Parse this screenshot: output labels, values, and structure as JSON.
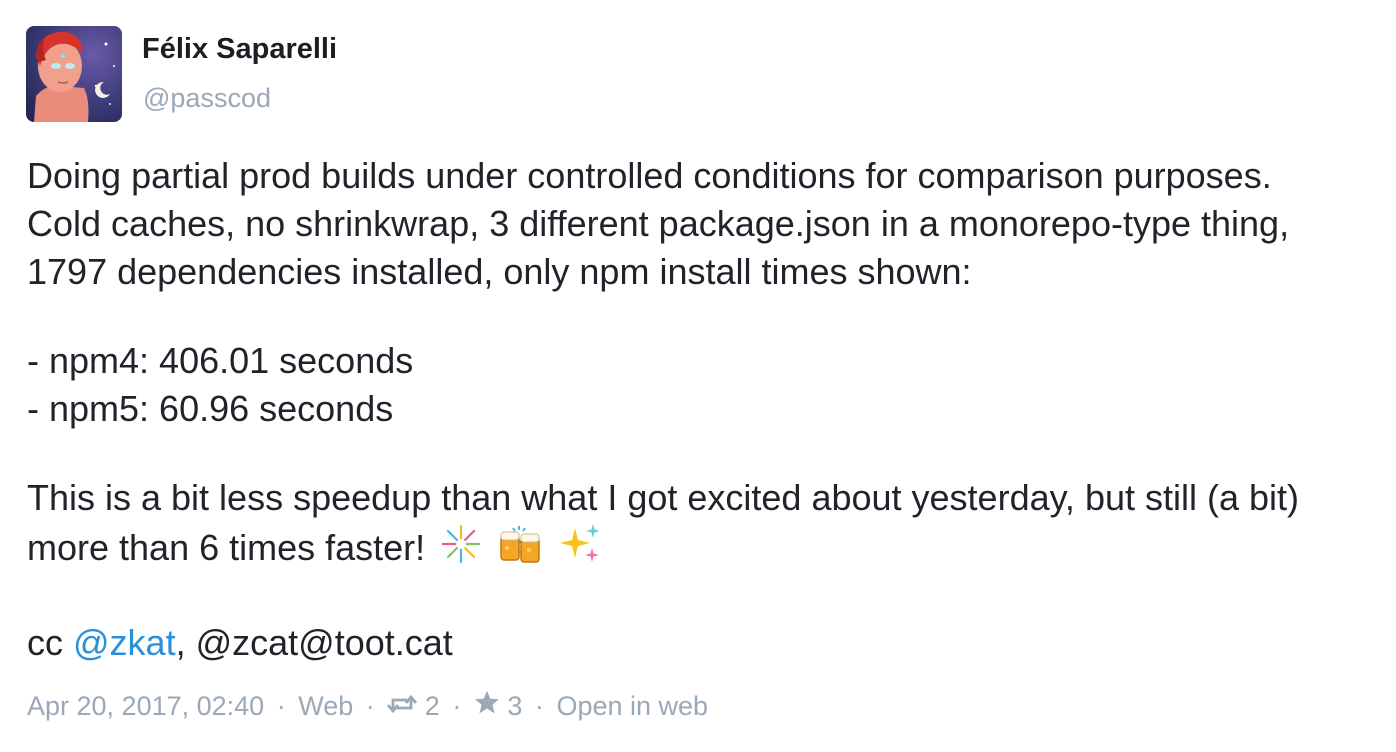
{
  "author": {
    "display_name": "Félix Saparelli",
    "handle": "@passcod"
  },
  "toot": {
    "paragraph1": [
      "Doing partial prod builds under controlled conditions for comparison purposes.",
      "Cold caches, no shrinkwrap, 3 different package.json in a monorepo-type thing,",
      "1797 dependencies installed, only npm install times shown:"
    ],
    "paragraph2": [
      "- npm4: 406.01 seconds",
      "- npm5: 60.96 seconds"
    ],
    "paragraph3_line1": "This is a bit less speedup than what I got excited about yesterday, but still (a bit)",
    "paragraph3_line2": "more than 6 times faster!",
    "emojis": [
      "fireworks-emoji",
      "beers-emoji",
      "sparkles-emoji"
    ],
    "cc_prefix": "cc ",
    "mention1": "@zkat",
    "cc_separator": ", ",
    "mention2": "@zcat@toot.cat"
  },
  "meta": {
    "timestamp": "Apr 20, 2017, 02:40",
    "dot": "·",
    "application": "Web",
    "reblogs_count": "2",
    "favourites_count": "3",
    "open_in_web": "Open in web"
  },
  "colors": {
    "mention": "#2b90d9",
    "meta_text": "#9aa8b7",
    "body_text": "#20242a"
  }
}
